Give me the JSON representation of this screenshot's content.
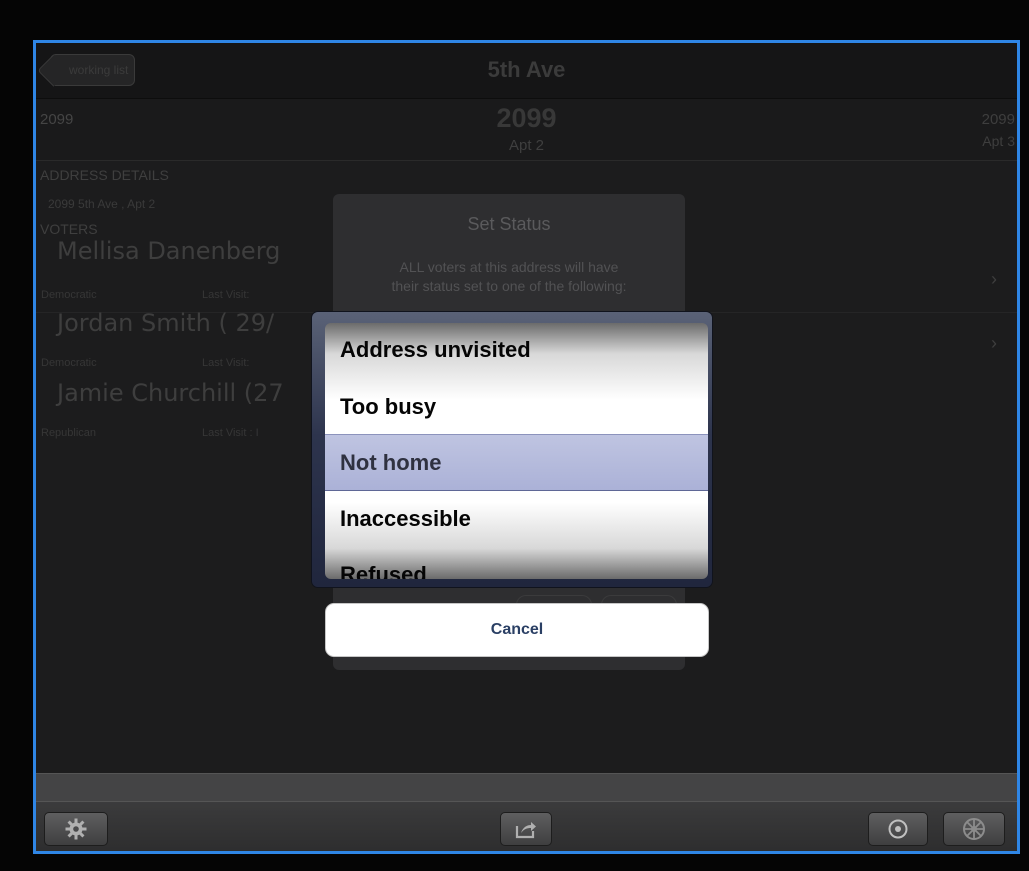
{
  "nav": {
    "back_label": "working list",
    "title": "5th Ave"
  },
  "address_strip": {
    "prev_number": "2099",
    "current_number": "2099",
    "current_apt": "Apt 2",
    "next_number": "2099",
    "next_apt": "Apt 3"
  },
  "details": {
    "address_header": "ADDRESS DETAILS",
    "address_line": "2099  5th Ave ,  Apt 2",
    "voters_header": "VOTERS"
  },
  "voters": [
    {
      "name": "Mellisa Danenberg",
      "party": "Democratic",
      "last_visit": "Last Visit:"
    },
    {
      "name": "Jordan Smith ( 29/",
      "party": "Democratic",
      "last_visit": "Last Visit:"
    },
    {
      "name": "Jamie Churchill (27",
      "party": "Republican",
      "last_visit": "Last Visit : I"
    }
  ],
  "alert": {
    "title": "Set Status",
    "message_line1": "ALL voters at this address will have",
    "message_line2": "their status set to one of the following:"
  },
  "picker": {
    "options": [
      "Address unvisited",
      "Too busy",
      "Not home",
      "Inaccessible",
      "Refused"
    ],
    "selected": "Not home"
  },
  "cancel_label": "Cancel",
  "toolbar": {
    "icons": [
      "gear-icon",
      "share-icon",
      "target-icon",
      "wheel-icon"
    ]
  }
}
